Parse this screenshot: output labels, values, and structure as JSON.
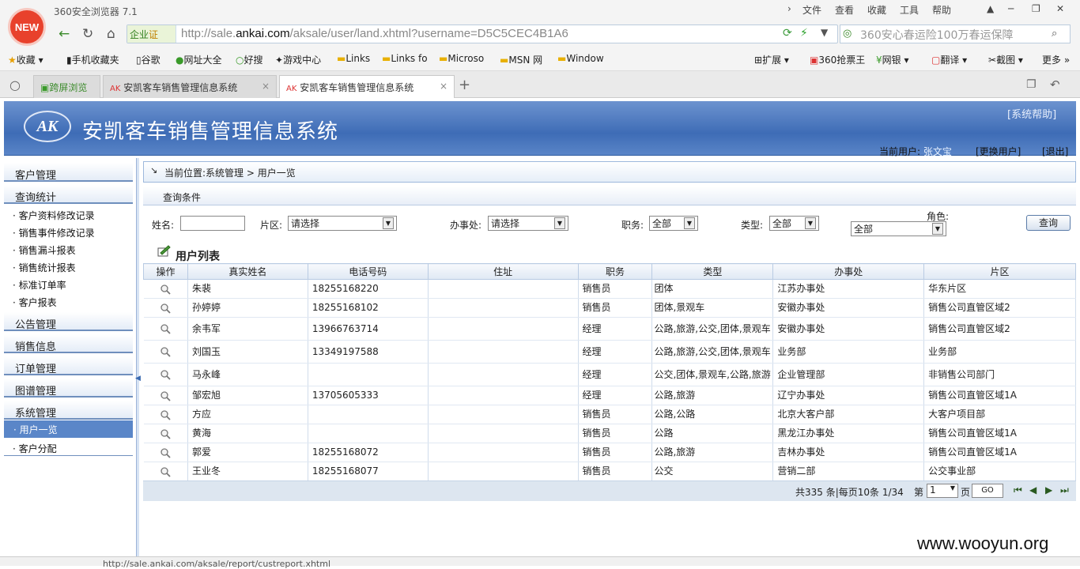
{
  "browser": {
    "logo_text": "NEW",
    "app_title": "360安全浏览器 7.1",
    "menu": [
      "文件",
      "查看",
      "收藏",
      "工具",
      "帮助"
    ],
    "qiye_label": "企业",
    "qiye_badge": "证",
    "url_prefix": "http://sale.",
    "url_domain": "ankai.com",
    "url_suffix": "/aksale/user/land.xhtml?username=D5C5CEC4B1A6",
    "search_placeholder": "360安心春运险100万春运保障",
    "bookmarks": [
      "收藏",
      "手机收藏夹",
      "谷歌",
      "网址大全",
      "好搜",
      "游戏中心",
      "Links",
      "Links fo",
      "Microso",
      "MSN 网",
      "Window"
    ],
    "bookmarks_right": [
      "扩展",
      "360抢票王",
      "网银",
      "翻译",
      "截图",
      "更多"
    ],
    "tabs": [
      "跨屏浏览",
      "安凯客车销售管理信息系统",
      "安凯客车销售管理信息系统"
    ],
    "status_url": "http://sale.ankai.com/aksale/report/custreport.xhtml",
    "watermark": "www.wooyun.org"
  },
  "header": {
    "logo": "AK",
    "title": "安凯客车销售管理信息系统",
    "help": "[系统帮助]",
    "current_user_label": "当前用户:",
    "current_user": "张文宝",
    "switch_user": "[更换用户]",
    "logout": "[退出]"
  },
  "sidebar": {
    "sections": [
      "客户管理",
      "查询统计",
      "公告管理",
      "销售信息",
      "订单管理",
      "图谱管理",
      "系统管理"
    ],
    "query_items": [
      "· 客户资料修改记录",
      "· 销售事件修改记录",
      "· 销售漏斗报表",
      "· 销售统计报表",
      "· 标准订单率",
      "· 客户报表"
    ],
    "system_items": [
      "· 用户一览",
      "· 客户分配"
    ]
  },
  "breadcrumb": "当前位置:系统管理 > 用户一览",
  "query": {
    "title": "查询条件",
    "name_label": "姓名:",
    "name_value": "",
    "area_label": "片区:",
    "area_value": "请选择",
    "office_label": "办事处:",
    "office_value": "请选择",
    "position_label": "职务:",
    "position_value": "全部",
    "type_label": "类型:",
    "type_value": "全部",
    "role_label": "角色:",
    "role_value": "全部",
    "button": "查询"
  },
  "list": {
    "title": "用户列表",
    "columns": [
      "操作",
      "真实姓名",
      "电话号码",
      "住址",
      "职务",
      "类型",
      "办事处",
      "片区"
    ],
    "rows": [
      [
        "朱裴",
        "18255168220",
        "",
        "销售员",
        "团体",
        "江苏办事处",
        "华东片区"
      ],
      [
        "孙婷婷",
        "18255168102",
        "",
        "销售员",
        "团体,景观车",
        "安徽办事处",
        "销售公司直管区域2"
      ],
      [
        "余韦军",
        "13966763714",
        "",
        "经理",
        "公路,旅游,公交,团体,景观车",
        "安徽办事处",
        "销售公司直管区域2"
      ],
      [
        "刘国玉",
        "13349197588",
        "",
        "经理",
        "公路,旅游,公交,团体,景观车",
        "业务部",
        "业务部"
      ],
      [
        "马永峰",
        "",
        "",
        "经理",
        "公交,团体,景观车,公路,旅游",
        "企业管理部",
        "非销售公司部门"
      ],
      [
        "邹宏旭",
        "13705605333",
        "",
        "经理",
        "公路,旅游",
        "辽宁办事处",
        "销售公司直管区域1A"
      ],
      [
        "方应",
        "",
        "",
        "销售员",
        "公路,公路",
        "北京大客户部",
        "大客户项目部"
      ],
      [
        "黄海",
        "",
        "",
        "销售员",
        "公路",
        "黑龙江办事处",
        "销售公司直管区域1A"
      ],
      [
        "郭爱",
        "18255168072",
        "",
        "销售员",
        "公路,旅游",
        "吉林办事处",
        "销售公司直管区域1A"
      ],
      [
        "王业冬",
        "18255168077",
        "",
        "销售员",
        "公交",
        "营销二部",
        "公交事业部"
      ]
    ]
  },
  "pager": {
    "summary": "共335 条|每页10条 1/34",
    "page_label": "第",
    "page_value": "1",
    "page_unit": "页",
    "go": "GO"
  }
}
